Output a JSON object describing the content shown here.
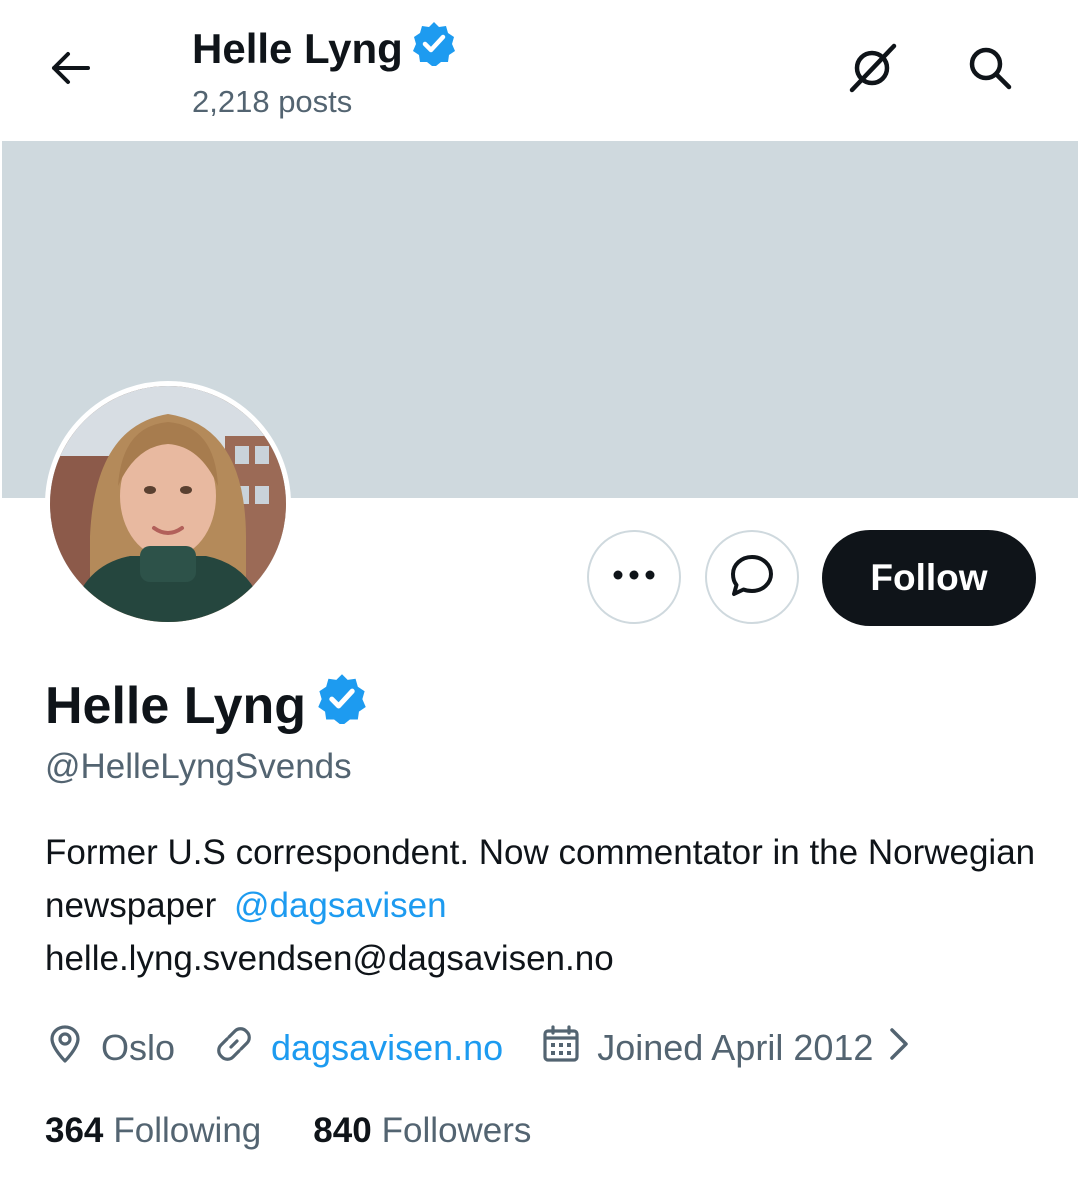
{
  "header": {
    "title": "Helle Lyng",
    "posts_count": "2,218 posts"
  },
  "profile": {
    "name": "Helle Lyng",
    "handle": "@HelleLyngSvends",
    "bio_text": "Former U.S correspondent. Now commentator in the Norwegian newspaper",
    "bio_mention": "@dagsavisen",
    "bio_email": "helle.lyng.svendsen@dagsavisen.no",
    "location": "Oslo",
    "website": "dagsavisen.no",
    "joined": "Joined April 2012",
    "following_count": "364",
    "following_label": "Following",
    "followers_count": "840",
    "followers_label": "Followers"
  },
  "actions": {
    "follow_label": "Follow"
  },
  "icons": [
    "back-arrow-icon",
    "grok-icon",
    "search-icon",
    "verified-badge-icon",
    "more-dots-icon",
    "message-icon",
    "location-pin-icon",
    "link-icon",
    "calendar-icon",
    "chevron-right-icon"
  ],
  "colors": {
    "accent": "#1d9bf0",
    "text_primary": "#0f1419",
    "text_secondary": "#536471",
    "banner": "#cfd9de",
    "follow_button_bg": "#0f1419"
  }
}
